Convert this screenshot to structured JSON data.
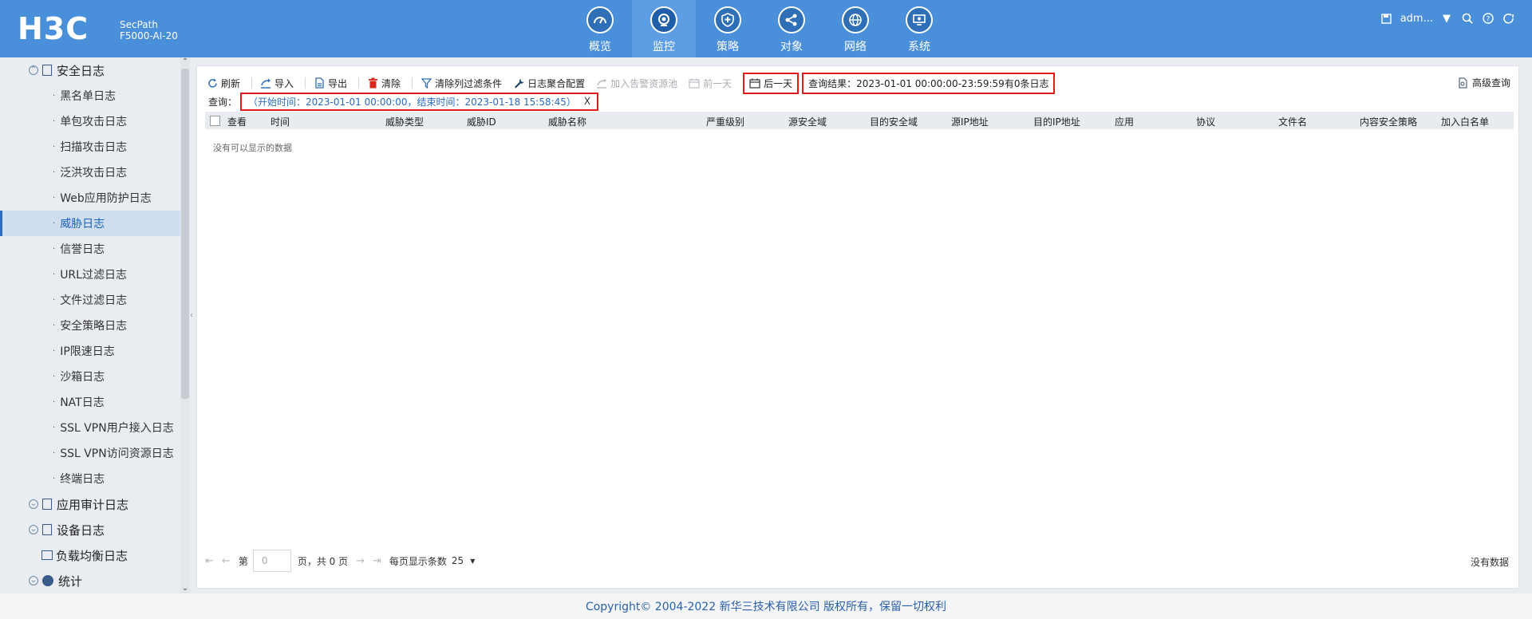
{
  "header": {
    "brand": "H3C",
    "product_line1": "SecPath",
    "product_line2": "F5000-AI-20",
    "nav": [
      {
        "label": "概览",
        "icon": "dashboard-icon"
      },
      {
        "label": "监控",
        "icon": "monitor-icon"
      },
      {
        "label": "策略",
        "icon": "shield-icon"
      },
      {
        "label": "对象",
        "icon": "share-icon"
      },
      {
        "label": "网络",
        "icon": "globe-icon"
      },
      {
        "label": "系统",
        "icon": "system-icon"
      }
    ],
    "active_nav": "监控",
    "user": "adm..."
  },
  "sidebar": {
    "groups": [
      {
        "label": "安全日志"
      },
      {
        "label": "应用审计日志"
      },
      {
        "label": "设备日志"
      },
      {
        "label": "负载均衡日志"
      },
      {
        "label": "统计"
      }
    ],
    "items": [
      {
        "label": "黑名单日志"
      },
      {
        "label": "单包攻击日志"
      },
      {
        "label": "扫描攻击日志"
      },
      {
        "label": "泛洪攻击日志"
      },
      {
        "label": "Web应用防护日志"
      },
      {
        "label": "威胁日志"
      },
      {
        "label": "信誉日志"
      },
      {
        "label": "URL过滤日志"
      },
      {
        "label": "文件过滤日志"
      },
      {
        "label": "安全策略日志"
      },
      {
        "label": "IP限速日志"
      },
      {
        "label": "沙箱日志"
      },
      {
        "label": "NAT日志"
      },
      {
        "label": "SSL VPN用户接入日志"
      },
      {
        "label": "SSL VPN访问资源日志"
      },
      {
        "label": "终端日志"
      }
    ],
    "active_item": "威胁日志"
  },
  "toolbar": {
    "refresh": "刷新",
    "import": "导入",
    "export": "导出",
    "clear": "清除",
    "clear_filters": "清除列过滤条件",
    "log_aggregation": "日志聚合配置",
    "add_alert_pool": "加入告警资源池",
    "prev_day": "前一天",
    "next_day": "后一天",
    "query_result": "查询结果：2023-01-01 00:00:00-23:59:59有0条日志",
    "advanced_query": "高级查询"
  },
  "query": {
    "label": "查询：",
    "condition": "（开始时间：2023-01-01 00:00:00，结束时间：2023-01-18 15:58:45）",
    "close": "X"
  },
  "table": {
    "columns": [
      "查看",
      "时间",
      "威胁类型",
      "威胁ID",
      "威胁名称",
      "严重级别",
      "源安全域",
      "目的安全域",
      "源IP地址",
      "目的IP地址",
      "应用",
      "协议",
      "文件名",
      "内容安全策略",
      "加入白名单"
    ],
    "empty_message": "没有可以显示的数据"
  },
  "pager": {
    "page_prefix": "第",
    "page_value": "0",
    "page_suffix": "页，共 0 页",
    "page_size_label": "每页显示条数",
    "page_size": "25",
    "no_data": "没有数据"
  },
  "footer": {
    "copyright": "Copyright© 2004-2022 新华三技术有限公司 版权所有，保留一切权利"
  },
  "colors": {
    "header_bg": "#4a8fd9",
    "highlight_red": "#e01b1b",
    "active_blue": "#1d62b8"
  }
}
